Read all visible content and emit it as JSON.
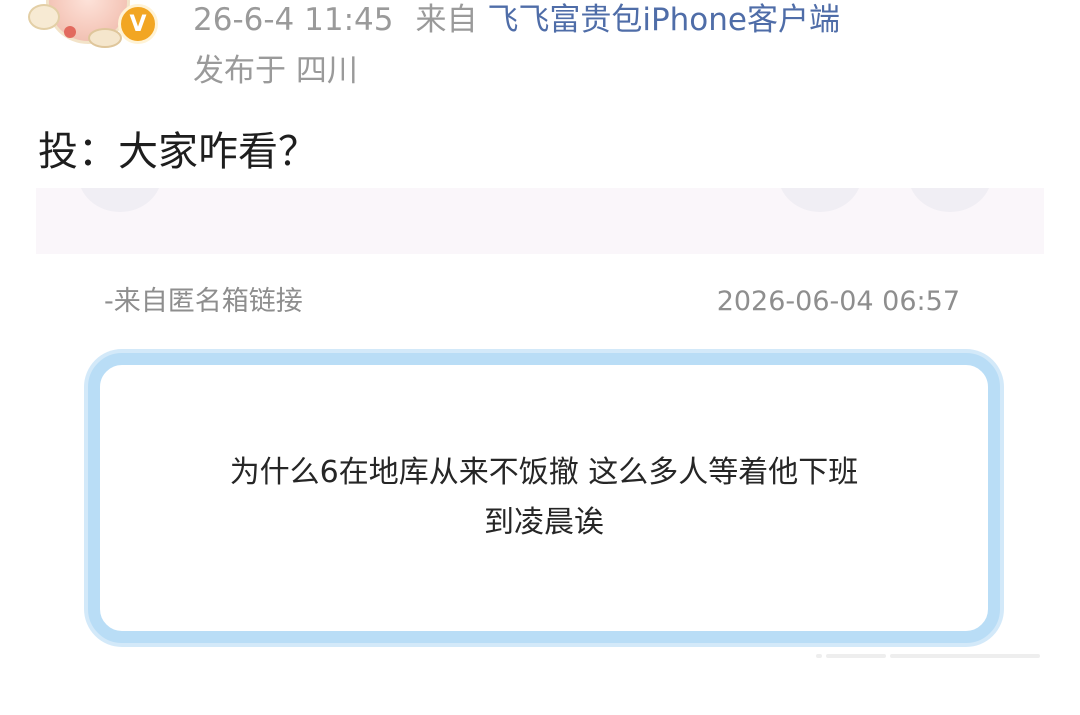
{
  "post": {
    "timestamp": "26-6-4 11:45",
    "source_prefix": "来自",
    "client_name": "飞飞富贵包iPhone客户端",
    "location": "发布于 四川",
    "text": "投：大家咋看？"
  },
  "embedded_screenshot": {
    "source_label": "-来自匿名箱链接",
    "timestamp": "2026-06-04 06:57",
    "question_line_1": "为什么6在地库从来不饭撤 这么多人等着他下班",
    "question_line_2": "到凌晨诶"
  },
  "colors": {
    "meta_gray": "#9a9a9a",
    "client_link": "#4f6da8",
    "card_border": "#b9ddf6",
    "badge_orange": "#f2a623"
  },
  "icons": {
    "verified_badge": "verified-v-badge-icon"
  }
}
